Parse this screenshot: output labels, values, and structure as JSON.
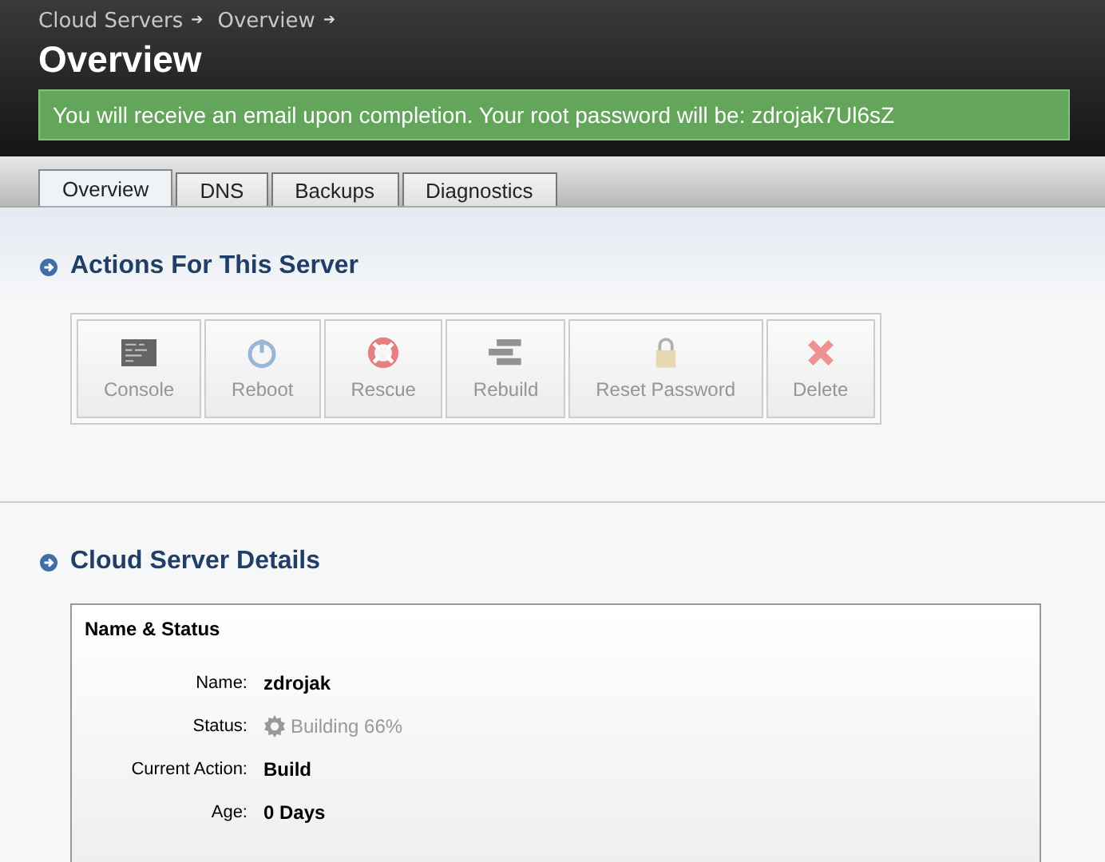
{
  "breadcrumb": [
    {
      "label": "Cloud Servers",
      "separator": "➔"
    },
    {
      "label": "Overview",
      "separator": "➔"
    }
  ],
  "title": "Overview",
  "notice": "You will receive an email upon completion. Your root password will be: zdrojak7Ul6sZ",
  "tabs": [
    {
      "label": "Overview",
      "selected": true
    },
    {
      "label": "DNS",
      "selected": false
    },
    {
      "label": "Backups",
      "selected": false
    },
    {
      "label": "Diagnostics",
      "selected": false
    }
  ],
  "actions_section": {
    "heading": "Actions For This Server",
    "actions": [
      {
        "label": "Console",
        "kind": "console",
        "disabled": true
      },
      {
        "label": "Reboot",
        "kind": "reboot",
        "disabled": true
      },
      {
        "label": "Rescue",
        "kind": "rescue",
        "disabled": true
      },
      {
        "label": "Rebuild",
        "kind": "rebuild",
        "disabled": true
      },
      {
        "label": "Reset Password",
        "kind": "lock",
        "disabled": true
      },
      {
        "label": "Delete",
        "kind": "delete",
        "disabled": true
      }
    ]
  },
  "details_section": {
    "heading": "Cloud Server Details",
    "card_title": "Name & Status",
    "fields": [
      {
        "label": "Name:",
        "value": "zdrojak",
        "kind": "text"
      },
      {
        "label": "Status:",
        "value": "Building 66%",
        "kind": "status"
      },
      {
        "label": "Current Action:",
        "value": "Build",
        "kind": "text"
      },
      {
        "label": "Age:",
        "value": "0 Days",
        "kind": "text"
      }
    ]
  }
}
